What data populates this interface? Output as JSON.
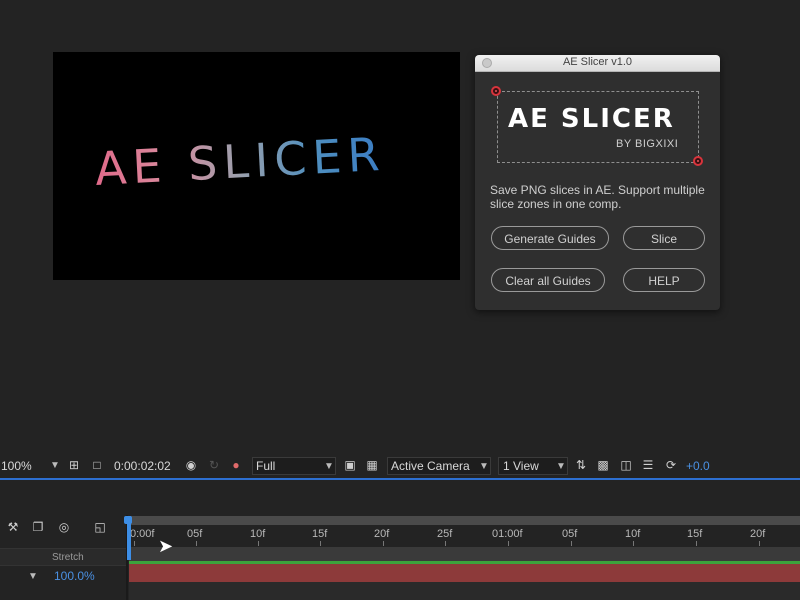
{
  "composition": {
    "title_text": "AE SLICER"
  },
  "panel": {
    "window_title": "AE Slicer v1.0",
    "logo_main": "AE SLICER",
    "logo_sub": "BY BIGXIXI",
    "description": "Save PNG slices in AE. Support multiple slice zones in one comp.",
    "buttons": {
      "generate": "Generate Guides",
      "slice": "Slice",
      "clear": "Clear all Guides",
      "help": "HELP"
    }
  },
  "toolbar": {
    "zoom": "100%",
    "timecode": "0:00:02:02",
    "resolution": "Full",
    "camera": "Active Camera",
    "view": "1 View",
    "exposure": "+0.0"
  },
  "timeline": {
    "stretch_label": "Stretch",
    "stretch_value": "100.0%",
    "ruler": [
      "0:00f",
      "05f",
      "10f",
      "15f",
      "20f",
      "25f",
      "01:00f",
      "05f",
      "10f",
      "15f",
      "20f"
    ]
  },
  "colors": {
    "accent_blue": "#3d8ee6",
    "layer_bar": "#8d3a3a",
    "guide_handle": "#d8343c"
  }
}
